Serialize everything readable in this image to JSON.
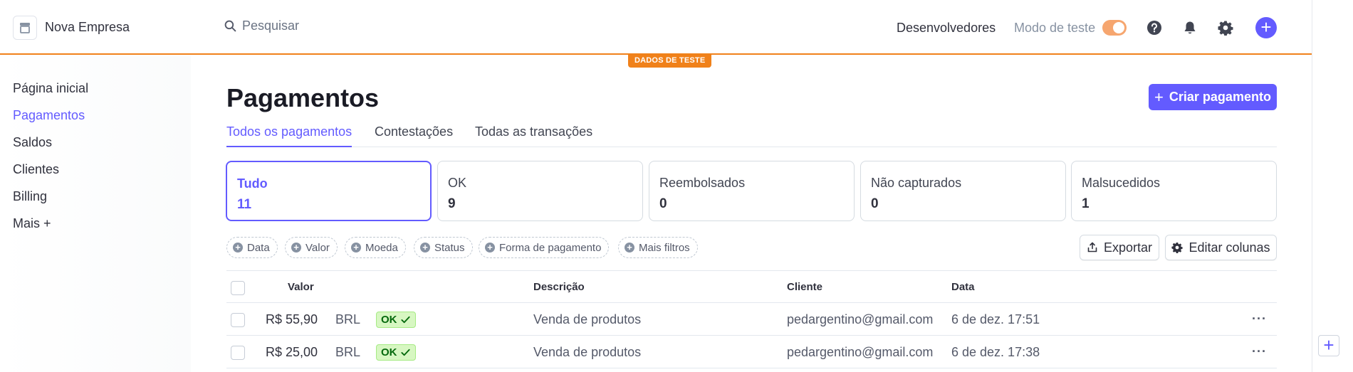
{
  "brand": {
    "name": "Nova Empresa",
    "icon": "store-icon"
  },
  "search": {
    "placeholder": "Pesquisar"
  },
  "topbar": {
    "developers_label": "Desenvolvedores",
    "test_mode_label": "Modo de teste",
    "test_mode_on": true,
    "icons": [
      "help-icon",
      "bell-icon",
      "gear-icon",
      "plus-icon"
    ],
    "accent_color": "#f0811a"
  },
  "test_badge": "DADOS DE TESTE",
  "sidebar": {
    "items": [
      {
        "label": "Página inicial",
        "active": false
      },
      {
        "label": "Pagamentos",
        "active": true
      },
      {
        "label": "Saldos",
        "active": false
      },
      {
        "label": "Clientes",
        "active": false
      },
      {
        "label": "Billing",
        "active": false
      },
      {
        "label": "Mais +",
        "active": false
      }
    ]
  },
  "main": {
    "title": "Pagamentos",
    "create_button": "Criar pagamento",
    "brand_color": "#635bff",
    "tabs": [
      {
        "label": "Todos os pagamentos",
        "active": true
      },
      {
        "label": "Contestações",
        "active": false
      },
      {
        "label": "Todas as transações",
        "active": false
      }
    ],
    "status_cards": [
      {
        "label": "Tudo",
        "count": "11",
        "active": true
      },
      {
        "label": "OK",
        "count": "9",
        "active": false
      },
      {
        "label": "Reembolsados",
        "count": "0",
        "active": false
      },
      {
        "label": "Não capturados",
        "count": "0",
        "active": false
      },
      {
        "label": "Malsucedidos",
        "count": "1",
        "active": false
      }
    ],
    "filters": [
      "Data",
      "Valor",
      "Moeda",
      "Status",
      "Forma de pagamento",
      "Mais filtros"
    ],
    "export_button": "Exportar",
    "edit_columns_button": "Editar colunas",
    "table": {
      "headers": {
        "amount": "Valor",
        "description": "Descrição",
        "customer": "Cliente",
        "date": "Data"
      },
      "rows": [
        {
          "amount": "R$ 55,90",
          "currency": "BRL",
          "status": "OK",
          "description": "Venda de produtos",
          "customer": "pedargentino@gmail.com",
          "date": "6 de dez. 17:51",
          "more": "···"
        },
        {
          "amount": "R$ 25,00",
          "currency": "BRL",
          "status": "OK",
          "description": "Venda de produtos",
          "customer": "pedargentino@gmail.com",
          "date": "6 de dez. 17:38",
          "more": "···"
        }
      ]
    }
  },
  "gutter": {
    "plus": "+"
  }
}
